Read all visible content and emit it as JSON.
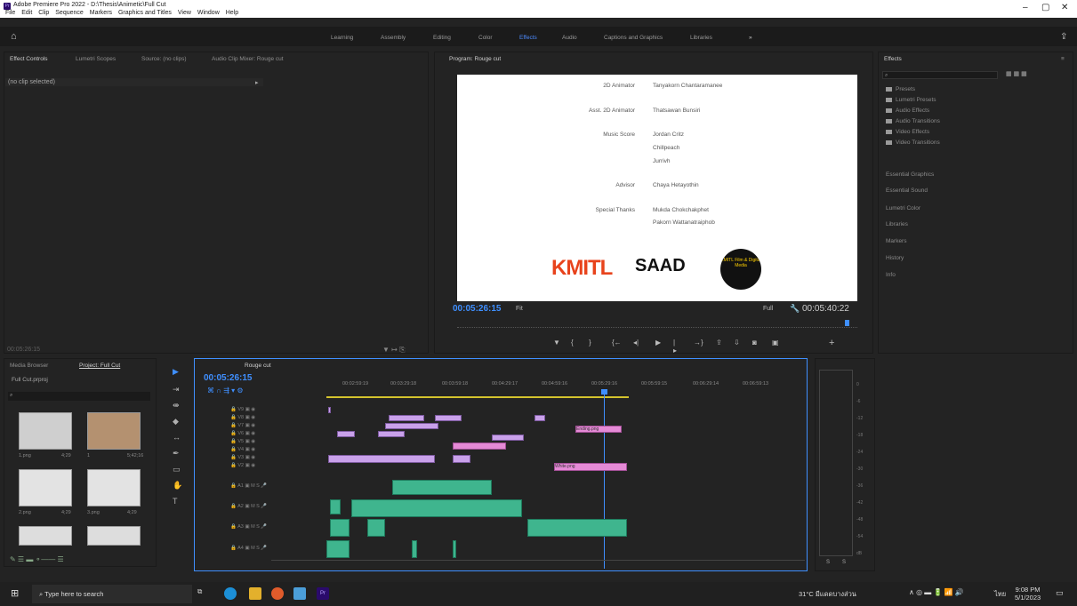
{
  "window": {
    "title": "Adobe Premiere Pro 2022 - D:\\Thesis\\Animetic\\Full Cut",
    "app_badge": "Pr",
    "min": "–",
    "max": "▢",
    "close": "✕"
  },
  "menu": [
    "File",
    "Edit",
    "Clip",
    "Sequence",
    "Markers",
    "Graphics and Titles",
    "View",
    "Window",
    "Help"
  ],
  "workspaces": [
    "Learning",
    "Assembly",
    "Editing",
    "Color",
    "Effects",
    "Audio",
    "Captions and Graphics",
    "Libraries"
  ],
  "workspace_active": "Effects",
  "workspace_more": "»",
  "left_panel": {
    "tabs": [
      "Effect Controls",
      "Lumetri Scopes",
      "Source: (no clips)",
      "Audio Clip Mixer: Rouge cut"
    ],
    "no_clip": "(no clip selected)",
    "timecode": "00:05:26:15"
  },
  "program": {
    "tab": "Program: Rouge cut",
    "credits": [
      {
        "role": "2D Animator",
        "names": [
          "Tanyakorn Chantaramanee"
        ]
      },
      {
        "role": "Asst. 2D Animator",
        "names": [
          "Thatsawan Bunsiri"
        ]
      },
      {
        "role": "Music Score",
        "names": [
          "Jordan Critz",
          "Chillpeach",
          "Jurrivh"
        ]
      },
      {
        "role": "Advisor",
        "names": [
          "Chaya Hetayothin"
        ]
      },
      {
        "role": "Special Thanks",
        "names": [
          "Mukda Chokchakphet",
          "Pakorn Wattanatraiphob"
        ]
      }
    ],
    "logos": {
      "kmitl": "KMITL",
      "saad": "SAAD",
      "film": "KMITL Film & Digital Media"
    },
    "timecode": "00:05:26:15",
    "fit": "Fit",
    "quality": "Full",
    "duration": "00:05:40:22"
  },
  "effects_panel": {
    "title": "Effects",
    "items": [
      "Presets",
      "Lumetri Presets",
      "Audio Effects",
      "Audio Transitions",
      "Video Effects",
      "Video Transitions"
    ],
    "sections": [
      "Essential Graphics",
      "Essential Sound",
      "Lumetri Color",
      "Libraries",
      "Markers",
      "History",
      "Info"
    ]
  },
  "project": {
    "tabs": [
      "Media Browser",
      "Project: Full Cut"
    ],
    "file": "Full Cut.prproj",
    "items": [
      {
        "name": "1.png",
        "dur": "4;29"
      },
      {
        "name": "1",
        "dur": "5;42;16"
      },
      {
        "name": "2.png",
        "dur": "4;29"
      },
      {
        "name": "3.png",
        "dur": "4;29"
      }
    ]
  },
  "timeline": {
    "tab": "Rouge cut",
    "timecode": "00:05:26:15",
    "ruler": [
      "00:02:59:19",
      "00:03:29:18",
      "00:03:59:18",
      "00:04:29:17",
      "00:04:59:16",
      "00:05:29:16",
      "00:05:59:15",
      "00:06:29:14",
      "00:06:59:13"
    ],
    "video_tracks": [
      "V9",
      "V8",
      "V7",
      "V6",
      "V5",
      "V4",
      "V3",
      "V2"
    ],
    "audio_tracks": [
      "A1",
      "A2",
      "A3",
      "A4"
    ],
    "clip_labels": {
      "ending": "Ending.png",
      "white": "White.png"
    }
  },
  "meter": {
    "scale": [
      "0",
      "-6",
      "-12",
      "-18",
      "-24",
      "-30",
      "-36",
      "-42",
      "-48",
      "-54",
      "dB"
    ],
    "solo": "S"
  },
  "taskbar": {
    "search": "Type here to search",
    "weather": "31°C  มีแดดบางส่วน",
    "lang": "ไทย",
    "time": "9:08 PM",
    "date": "5/1/2023"
  },
  "colors": {
    "accent": "#3f8fff",
    "video_clip": "#c9a1ea",
    "pink_clip": "#e58ad6",
    "audio_clip": "#3fb58e"
  }
}
